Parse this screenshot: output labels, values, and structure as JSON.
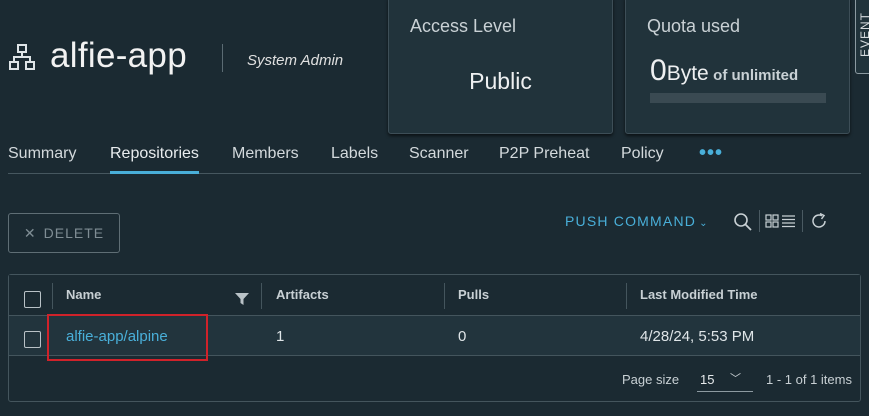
{
  "project": {
    "name": "alfie-app",
    "role": "System Admin",
    "icon": "project-tree-icon"
  },
  "cards": {
    "access_label": "Access Level",
    "access_value": "Public",
    "quota_label": "Quota used",
    "quota_number": "0",
    "quota_unit": "Byte",
    "quota_suffix": "of unlimited"
  },
  "side_tab": {
    "label": "EVENT"
  },
  "tabs": [
    {
      "label": "Summary"
    },
    {
      "label": "Repositories",
      "active": true
    },
    {
      "label": "Members"
    },
    {
      "label": "Labels"
    },
    {
      "label": "Scanner"
    },
    {
      "label": "P2P Preheat"
    },
    {
      "label": "Policy"
    }
  ],
  "more_label": "•••",
  "toolbar": {
    "delete_label": "DELETE",
    "push_command_label": "PUSH COMMAND"
  },
  "table": {
    "columns": [
      "Name",
      "Artifacts",
      "Pulls",
      "Last Modified Time"
    ],
    "rows": [
      {
        "name": "alfie-app/alpine",
        "artifacts": "1",
        "pulls": "0",
        "modified": "4/28/24, 5:53 PM"
      }
    ],
    "footer": {
      "page_size_label": "Page size",
      "page_size_value": "15",
      "range_text": "1 - 1 of 1 items"
    }
  },
  "colors": {
    "background": "#1b2a32",
    "accent": "#49afd9",
    "highlight": "#d0222a"
  }
}
